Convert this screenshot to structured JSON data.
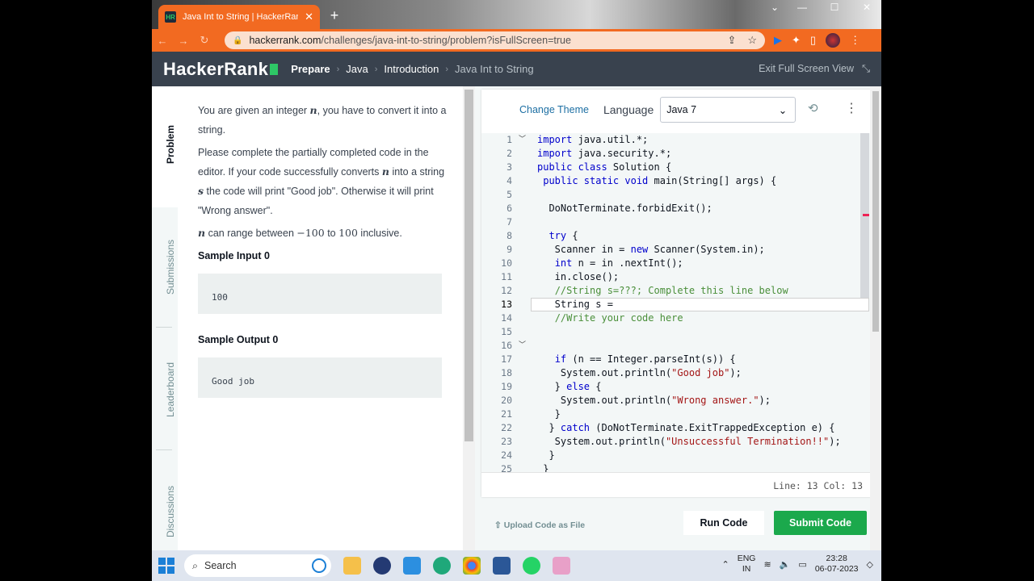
{
  "browser": {
    "tab_title": "Java Int to String | HackerRank",
    "tab_favicon": "HR",
    "url_host": "hackerrank.com",
    "url_path": "/challenges/java-int-to-string/problem?isFullScreen=true",
    "accent_color": "#f26a21"
  },
  "header": {
    "logo": "HackerRank",
    "breadcrumbs": [
      "Prepare",
      "Java",
      "Introduction",
      "Java Int to String"
    ],
    "exit_fullscreen": "Exit Full Screen View"
  },
  "side_tabs": [
    "Problem",
    "Submissions",
    "Leaderboard",
    "Discussions"
  ],
  "problem": {
    "p1_a": "You are given an integer ",
    "p1_var": "n",
    "p1_b": ", you have to convert it into a string.",
    "p2_a": "Please complete the partially completed code in the editor. If your code successfully converts ",
    "p2_var": "n",
    "p2_b": " into a string ",
    "p2_var2": "s",
    "p2_c": " the code will print \"Good job\". Otherwise it will print \"Wrong answer\".",
    "p3_var": "n",
    "p3_a": " can range between ",
    "p3_min": "−100",
    "p3_b": " to ",
    "p3_max": "100",
    "p3_c": " inclusive.",
    "sample_input_title": "Sample Input 0",
    "sample_input": "100",
    "sample_output_title": "Sample Output 0",
    "sample_output": "Good job"
  },
  "editor": {
    "change_theme": "Change Theme",
    "language_label": "Language",
    "language": "Java 7",
    "status": "Line: 13 Col: 13",
    "run": "Run Code",
    "submit": "Submit Code",
    "upload": "Upload Code as File",
    "lines": [
      "1",
      "2",
      "3",
      "4",
      "5",
      "6",
      "7",
      "8",
      "9",
      "10",
      "11",
      "12",
      "13",
      "14",
      "15",
      "16",
      "17",
      "18",
      "19",
      "20",
      "21",
      "22",
      "23",
      "24",
      "25"
    ]
  },
  "taskbar": {
    "search": "Search",
    "lang1": "ENG",
    "lang2": "IN",
    "time": "23:28",
    "date": "06-07-2023"
  }
}
